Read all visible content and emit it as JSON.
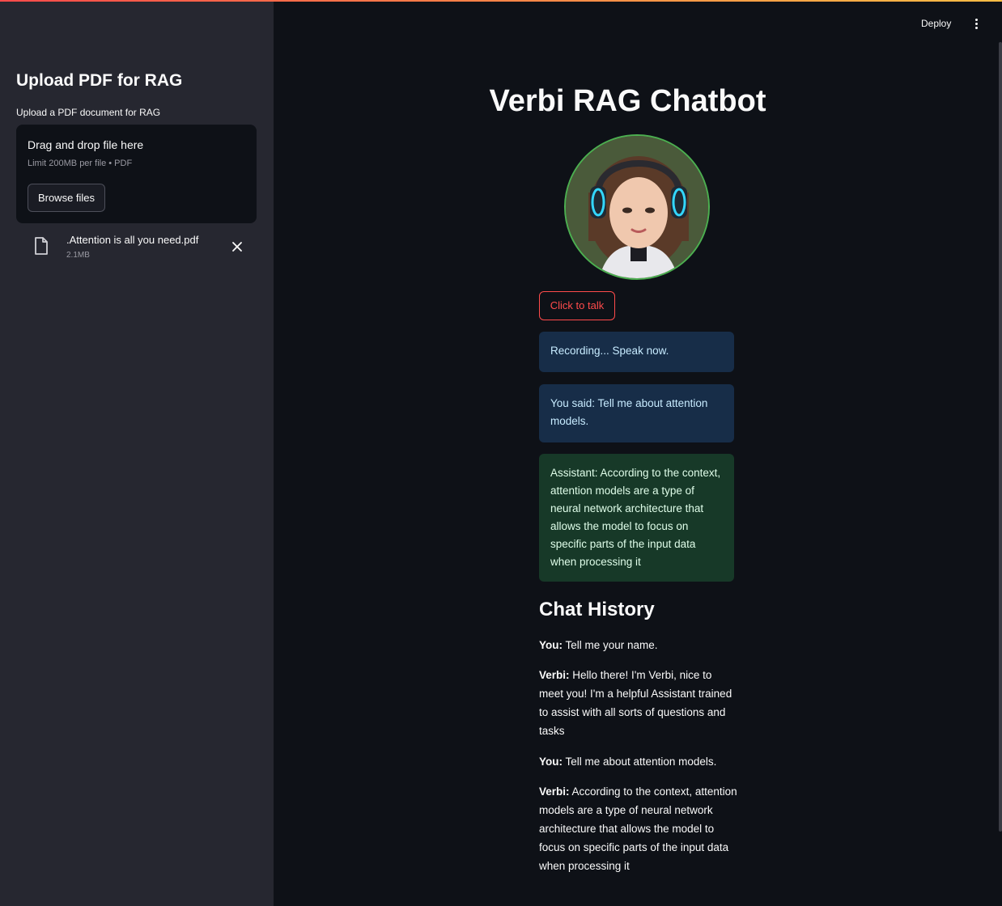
{
  "sidebar": {
    "title": "Upload PDF for RAG",
    "uploader_label": "Upload a PDF document for RAG",
    "dropzone": {
      "title": "Drag and drop file here",
      "limit": "Limit 200MB per file • PDF",
      "browse_label": "Browse files"
    },
    "file": {
      "name": ".Attention is all you need.pdf",
      "size": "2.1MB",
      "icon": "file-icon",
      "remove_icon": "close-icon"
    }
  },
  "header": {
    "deploy_label": "Deploy",
    "menu_icon": "kebab-menu-icon"
  },
  "main": {
    "title": "Verbi RAG Chatbot",
    "talk_button": "Click to talk",
    "status_recording": "Recording... Speak now.",
    "status_you_said": "You said: Tell me about attention models.",
    "status_assistant": "Assistant: According to the context, attention models are a type of neural network architecture that allows the model to focus on specific parts of the input data when processing it",
    "history_title": "Chat History",
    "history": [
      {
        "speaker": "You:",
        "text": " Tell me your name."
      },
      {
        "speaker": "Verbi:",
        "text": " Hello there! I'm Verbi, nice to meet you! I'm a helpful Assistant trained to assist with all sorts of questions and tasks"
      },
      {
        "speaker": "You:",
        "text": " Tell me about attention models."
      },
      {
        "speaker": "Verbi:",
        "text": " According to the context, attention models are a type of neural network architecture that allows the model to focus on specific parts of the input data when processing it"
      }
    ]
  },
  "colors": {
    "accent": "#ff4b4b",
    "info_bg": "#172d48",
    "success_bg": "#173928",
    "avatar_border": "#4caf50"
  }
}
